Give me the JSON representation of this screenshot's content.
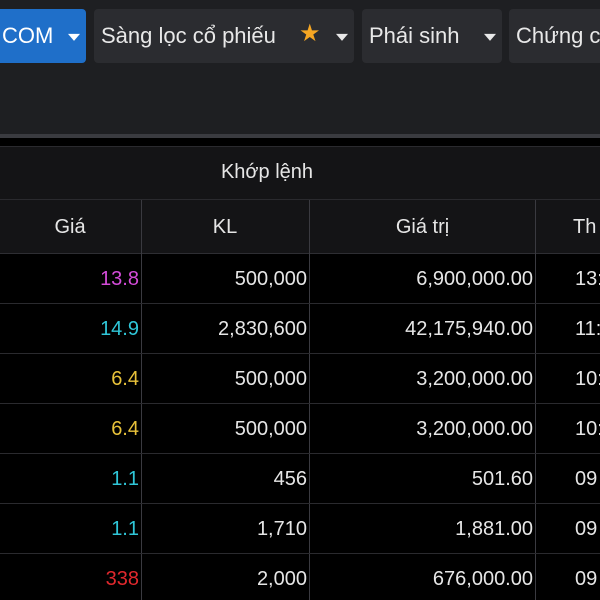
{
  "nav": {
    "tabs": [
      {
        "label": "COM",
        "active": true
      },
      {
        "label": "Sàng lọc cổ phiếu",
        "starred": true
      },
      {
        "label": "Phái sinh"
      },
      {
        "label": "Chứng c"
      }
    ]
  },
  "table": {
    "group_title": "Khớp lệnh",
    "columns": [
      "Giá",
      "KL",
      "Giá trị",
      "Th"
    ],
    "rows": [
      {
        "price": "13.8",
        "price_color": "#d34bd8",
        "volume": "500,000",
        "value": "6,900,000.00",
        "time": "13:"
      },
      {
        "price": "14.9",
        "price_color": "#2fc6d8",
        "volume": "2,830,600",
        "value": "42,175,940.00",
        "time": "11:"
      },
      {
        "price": "6.4",
        "price_color": "#e8c23a",
        "volume": "500,000",
        "value": "3,200,000.00",
        "time": "10:"
      },
      {
        "price": "6.4",
        "price_color": "#e8c23a",
        "volume": "500,000",
        "value": "3,200,000.00",
        "time": "10:"
      },
      {
        "price": "1.1",
        "price_color": "#2fc6d8",
        "volume": "456",
        "value": "501.60",
        "time": "09"
      },
      {
        "price": "1.1",
        "price_color": "#2fc6d8",
        "volume": "1,710",
        "value": "1,881.00",
        "time": "09"
      },
      {
        "price": "338",
        "price_color": "#e0282d",
        "volume": "2,000",
        "value": "676,000.00",
        "time": "09"
      }
    ]
  }
}
